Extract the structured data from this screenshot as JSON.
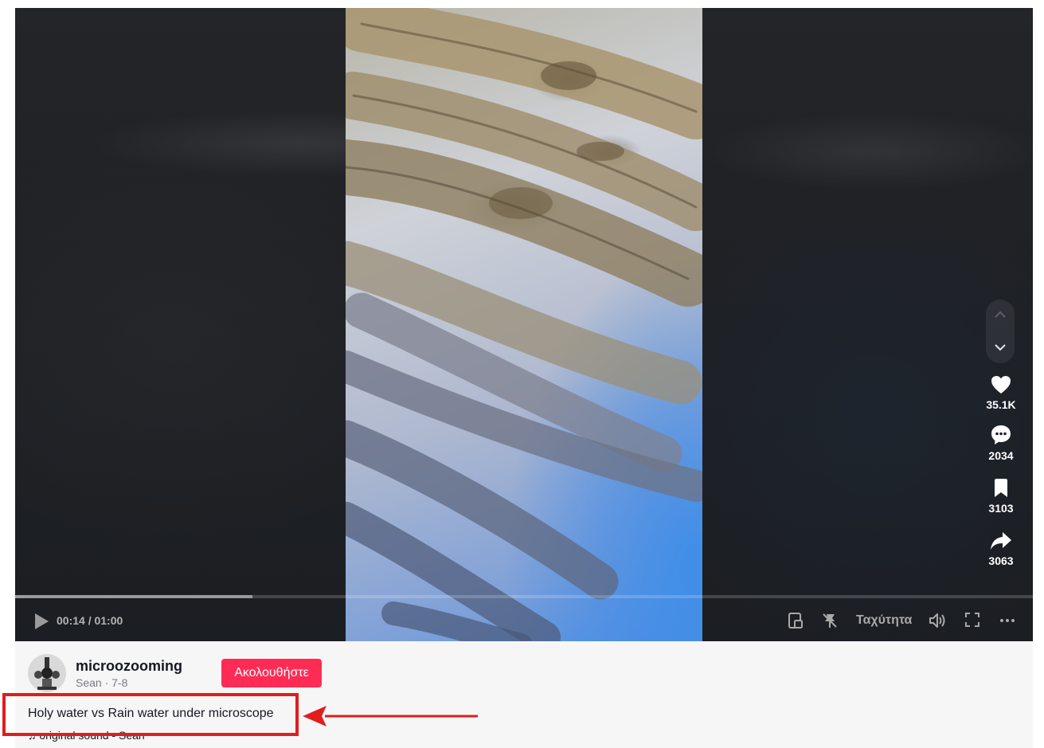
{
  "player": {
    "time_current": "00:14",
    "time_total": "01:00",
    "time_display": "00:14 / 01:00",
    "progress_fraction": 0.2333,
    "speed_label": "Ταχύτητα",
    "icons": [
      "play-icon",
      "floating-player-icon",
      "pin-icon",
      "volume-icon",
      "fullscreen-icon",
      "more-icon"
    ]
  },
  "actions": {
    "likes": "35.1K",
    "comments": "2034",
    "saves": "3103",
    "shares": "3063"
  },
  "author": {
    "username": "microozooming",
    "subtitle": "Sean · 7-8",
    "follow_label": "Ακολουθήστε"
  },
  "video": {
    "caption": "Holy water vs Rain water under microscope",
    "sound": "original sound - Sean"
  },
  "colors": {
    "accent": "#fe2c55",
    "annotation": "#e01e1e",
    "player_bg": "#1e2024"
  }
}
